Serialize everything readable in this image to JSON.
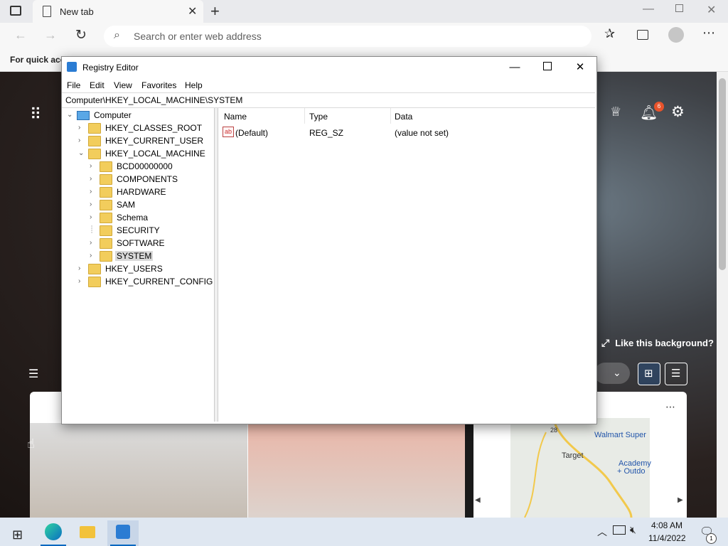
{
  "browser": {
    "tab_title": "New tab",
    "address_placeholder": "Search or enter web address",
    "favorites_hint": "For quick acc",
    "background_hint": "Like this background?",
    "notification_count": "6"
  },
  "registry": {
    "title": "Registry Editor",
    "menu": [
      "File",
      "Edit",
      "View",
      "Favorites",
      "Help"
    ],
    "path": "Computer\\HKEY_LOCAL_MACHINE\\SYSTEM",
    "tree": {
      "root": "Computer",
      "hives": [
        "HKEY_CLASSES_ROOT",
        "HKEY_CURRENT_USER",
        "HKEY_LOCAL_MACHINE",
        "HKEY_USERS",
        "HKEY_CURRENT_CONFIG"
      ],
      "hklm_children": [
        "BCD00000000",
        "COMPONENTS",
        "HARDWARE",
        "SAM",
        "Schema",
        "SECURITY",
        "SOFTWARE",
        "SYSTEM"
      ],
      "selected": "SYSTEM"
    },
    "columns": [
      "Name",
      "Type",
      "Data"
    ],
    "values": [
      {
        "name": "(Default)",
        "type": "REG_SZ",
        "data": "(value not set)"
      }
    ]
  },
  "map": {
    "labels": [
      "Walmart Super",
      "Target",
      "Academy",
      "+ Outdo",
      "28"
    ]
  },
  "taskbar": {
    "time": "4:08 AM",
    "date": "11/4/2022",
    "notification_count": "1"
  }
}
